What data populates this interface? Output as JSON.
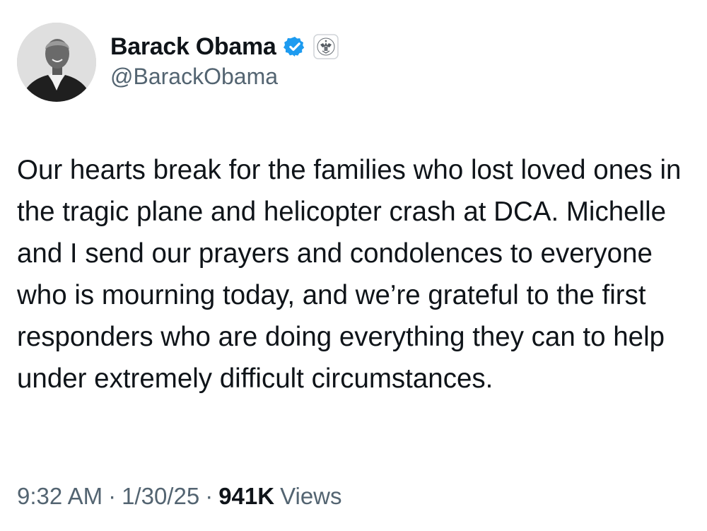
{
  "author": {
    "display_name": "Barack Obama",
    "handle": "@BarackObama",
    "verified_badge_icon": "verified-checkmark-icon",
    "verified_badge_color": "#1d9bf0",
    "affiliation_icon": "us-government-seal-icon"
  },
  "tweet": {
    "text": "Our hearts break for the families who lost loved ones in the tragic plane and helicopter crash at DCA. Michelle and I send our prayers and condolences to everyone who is mourning today, and we’re grateful to the first responders who are doing everything they can to help under extremely difficult circumstances."
  },
  "meta": {
    "time": "9:32 AM",
    "separator": "·",
    "date": "1/30/25",
    "views_count": "941K",
    "views_label": "Views"
  },
  "colors": {
    "text_primary": "#0f1419",
    "text_secondary": "#536471",
    "accent": "#1d9bf0"
  }
}
